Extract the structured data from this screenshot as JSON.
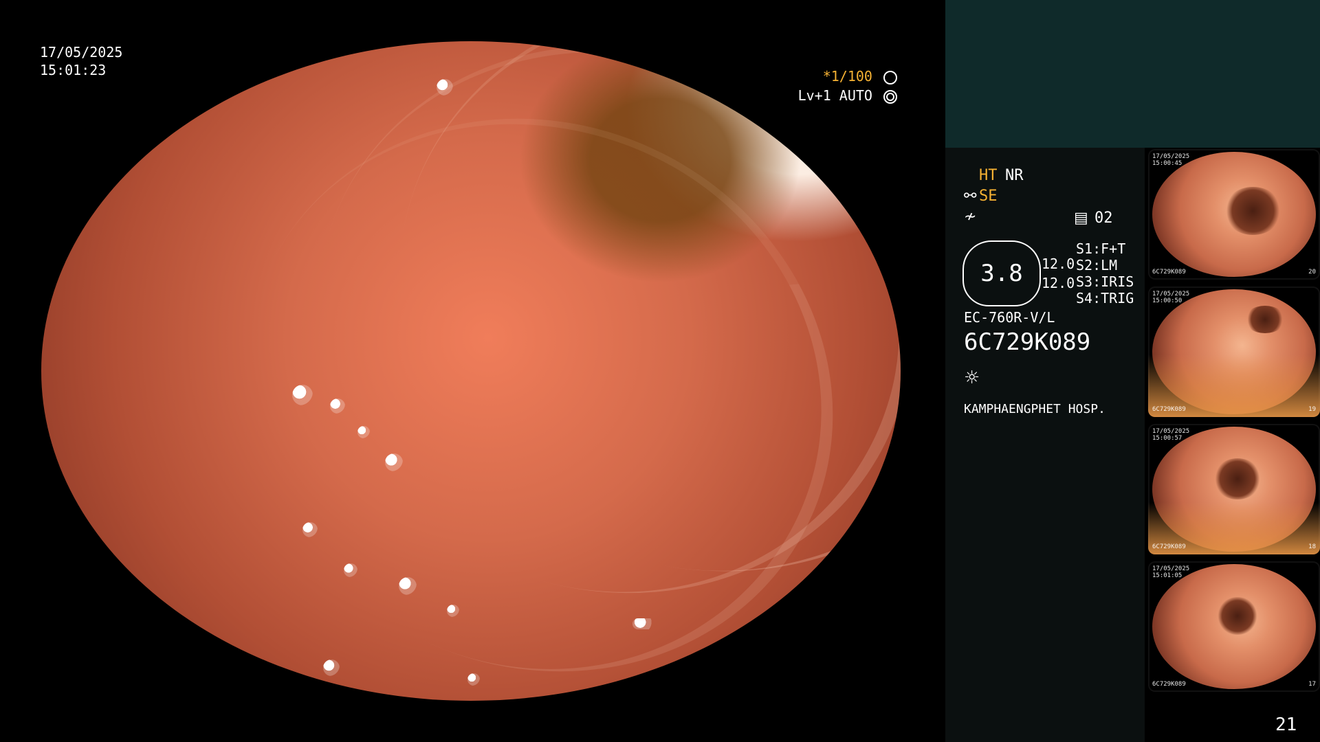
{
  "overlay": {
    "date": "17/05/2025",
    "time": "15:01:23",
    "shutter": "*1/100",
    "level_mode": "Lv+1 AUTO"
  },
  "info": {
    "ht": "HT",
    "nr": "NR",
    "se": "SE",
    "page_code": "02",
    "scope_value": "3.8",
    "value_a": "12.0",
    "value_b": "12.0",
    "settings": [
      {
        "key": "S1:",
        "value": "F+T"
      },
      {
        "key": "S2:",
        "value": "LM"
      },
      {
        "key": "S3:",
        "value": "IRIS"
      },
      {
        "key": "S4:",
        "value": "TRIG"
      }
    ],
    "model": "EC-760R-V/L",
    "serial": "6C729K089",
    "hospital": "KAMPHAENGPHET HOSP."
  },
  "thumbs": [
    {
      "tiny_top": "17/05/2025\n15:00:45",
      "tiny_bottom": "6C729K089",
      "num": "20"
    },
    {
      "tiny_top": "17/05/2025\n15:00:50",
      "tiny_bottom": "6C729K089",
      "num": "19"
    },
    {
      "tiny_top": "17/05/2025\n15:00:57",
      "tiny_bottom": "6C729K089",
      "num": "18"
    },
    {
      "tiny_top": "17/05/2025\n15:01:05",
      "tiny_bottom": "6C729K089",
      "num": "17"
    }
  ],
  "page_number": "21",
  "icons": {
    "aperture": "aperture-icon",
    "lamp": "lamp-icon",
    "record": "record-icon",
    "brightness": "sun-icon"
  },
  "colors": {
    "amber": "#f6b233",
    "panel_teal": "#0f2a2a"
  }
}
